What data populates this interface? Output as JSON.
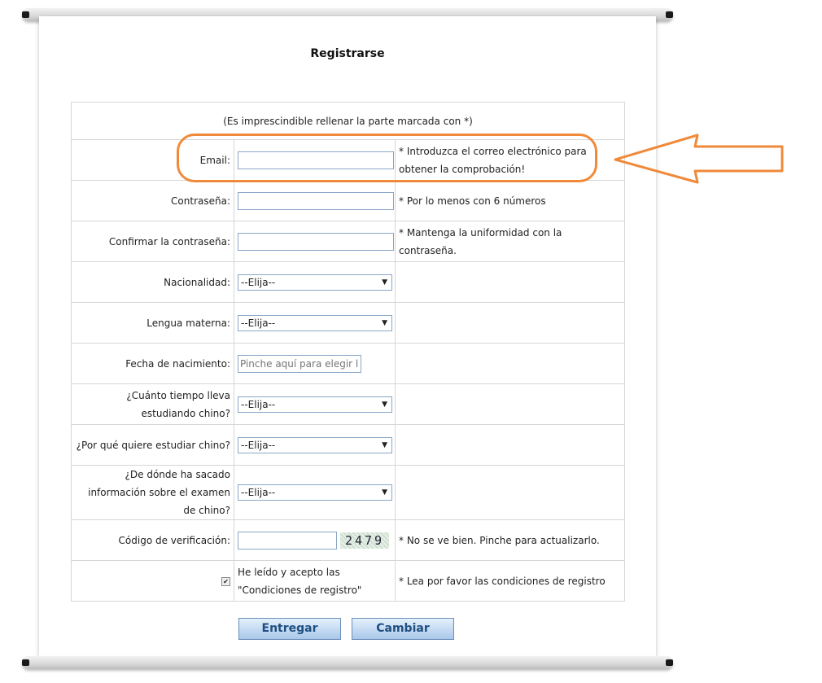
{
  "page": {
    "title": "Registrarse"
  },
  "form": {
    "required_note": "(Es imprescindible rellenar la parte marcada con *)",
    "email": {
      "label": "Email:",
      "value": "",
      "hint": "* Introduzca el correo electrónico para obtener la comprobación!"
    },
    "password": {
      "label": "Contraseña:",
      "value": "",
      "hint": "* Por lo menos con 6 números"
    },
    "confirm_password": {
      "label": "Confirmar la contraseña:",
      "value": "",
      "hint": "* Mantenga la uniformidad con la contraseña."
    },
    "nationality": {
      "label": "Nacionalidad:",
      "selected": "--Elija--"
    },
    "mother_tongue": {
      "label": "Lengua materna:",
      "selected": "--Elija--"
    },
    "birth_date": {
      "label": "Fecha de nacimiento:",
      "placeholder": "Pinche aquí para elegir la fecha"
    },
    "study_time": {
      "label": "¿Cuánto tiempo lleva estudiando chino?",
      "selected": "--Elija--"
    },
    "study_reason": {
      "label": "¿Por qué quiere estudiar chino?",
      "selected": "--Elija--"
    },
    "info_source": {
      "label": "¿De dónde ha sacado información sobre el examen de chino?",
      "selected": "--Elija--"
    },
    "verification": {
      "label": "Código de verificación:",
      "value": "",
      "captcha_text": "2479",
      "hint": "* No se ve bien. Pinche para actualizarlo."
    },
    "terms": {
      "checked": true,
      "text": "He leído y acepto las \"Condiciones de registro\"",
      "hint": "* Lea por favor las condiciones de registro"
    }
  },
  "buttons": {
    "submit": "Entregar",
    "reset": "Cambiar"
  },
  "annotation": {
    "color": "#f08a3a"
  }
}
